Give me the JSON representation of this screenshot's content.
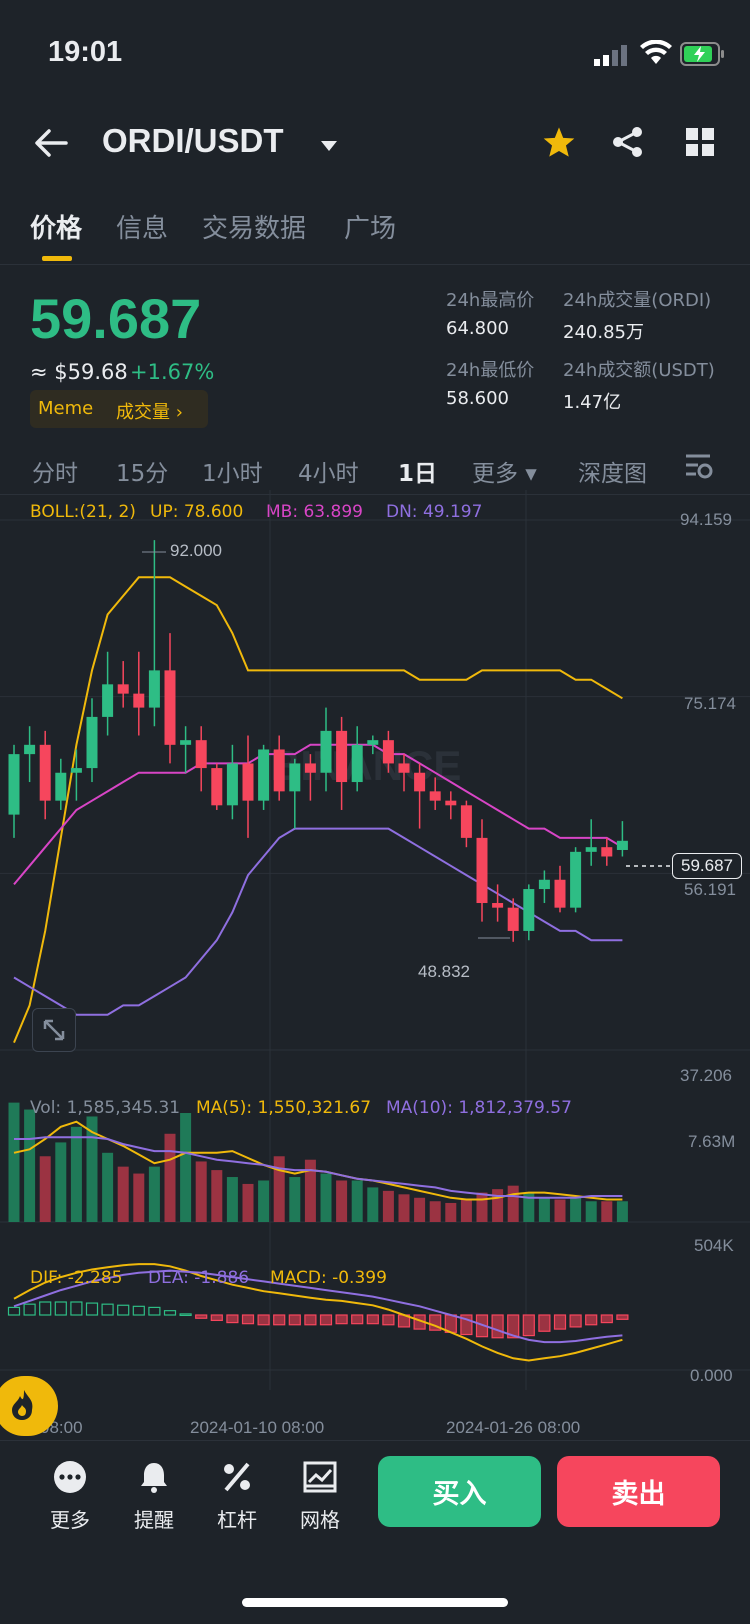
{
  "status_bar": {
    "time": "19:01"
  },
  "nav": {
    "pair": "ORDI/USDT"
  },
  "tabs": [
    "价格",
    "信息",
    "交易数据",
    "广场"
  ],
  "price": {
    "last": "59.687",
    "usd": "≈ $59.68",
    "change": "+1.67%",
    "tag_meme": "Meme",
    "tag_volume": "成交量 ›"
  },
  "stats": {
    "high_label": "24h最高价",
    "high": "64.800",
    "vol_ordi_label": "24h成交量(ORDI)",
    "vol_ordi": "240.85万",
    "low_label": "24h最低价",
    "low": "58.600",
    "vol_usdt_label": "24h成交额(USDT)",
    "vol_usdt": "1.47亿"
  },
  "intervals": [
    "分时",
    "15分",
    "1小时",
    "4小时",
    "1日",
    "更多 ▾",
    "深度图"
  ],
  "boll": {
    "label": "BOLL:(21, 2)",
    "up": "UP: 78.600",
    "mb": "MB: 63.899",
    "dn": "DN: 49.197"
  },
  "vol_legend": {
    "vol": "Vol: 1,585,345.31",
    "ma5": "MA(5): 1,550,321.67",
    "ma10": "MA(10): 1,812,379.57"
  },
  "macd_legend": {
    "dif": "DIF: -2.285",
    "dea": "DEA: -1.886",
    "macd": "MACD: -0.399"
  },
  "axis": {
    "price_ticks": [
      "94.159",
      "75.174",
      "56.191",
      "37.206"
    ],
    "vol_ticks": [
      "7.63M",
      "504K"
    ],
    "macd_tick": "0.000",
    "current_price": "59.687",
    "max_marker": "92.000",
    "min_marker": "48.832",
    "x_ticks": [
      "08:00",
      "2024-01-10 08:00",
      "2024-01-26 08:00"
    ]
  },
  "watermark": "BINANCE",
  "toolbar": {
    "more": "更多",
    "alert": "提醒",
    "margin": "杠杆",
    "grid": "网格"
  },
  "actions": {
    "buy": "买入",
    "sell": "卖出"
  },
  "colors": {
    "up": "#2ebd85",
    "down": "#f6465d",
    "boll_up": "#f0b90b",
    "boll_mb": "#d845c6",
    "boll_dn": "#8f6fe0",
    "accent": "#f0b90b"
  },
  "chart_data": {
    "type": "candlestick",
    "price_range": [
      37.206,
      94.159
    ],
    "candles": [
      {
        "o": 62.5,
        "h": 70.0,
        "l": 60.0,
        "c": 69.0
      },
      {
        "o": 69.0,
        "h": 72.0,
        "l": 66.0,
        "c": 70.0
      },
      {
        "o": 70.0,
        "h": 71.5,
        "l": 62.0,
        "c": 64.0
      },
      {
        "o": 64.0,
        "h": 68.5,
        "l": 63.0,
        "c": 67.0
      },
      {
        "o": 67.0,
        "h": 69.5,
        "l": 64.0,
        "c": 67.5
      },
      {
        "o": 67.5,
        "h": 75.0,
        "l": 66.0,
        "c": 73.0
      },
      {
        "o": 73.0,
        "h": 80.0,
        "l": 71.0,
        "c": 76.5
      },
      {
        "o": 76.5,
        "h": 79.0,
        "l": 74.0,
        "c": 75.5
      },
      {
        "o": 75.5,
        "h": 80.0,
        "l": 71.0,
        "c": 74.0
      },
      {
        "o": 74.0,
        "h": 92.0,
        "l": 72.0,
        "c": 78.0
      },
      {
        "o": 78.0,
        "h": 82.0,
        "l": 68.0,
        "c": 70.0
      },
      {
        "o": 70.0,
        "h": 72.0,
        "l": 67.0,
        "c": 70.5
      },
      {
        "o": 70.5,
        "h": 72.0,
        "l": 65.0,
        "c": 67.5
      },
      {
        "o": 67.5,
        "h": 68.0,
        "l": 63.0,
        "c": 63.5
      },
      {
        "o": 63.5,
        "h": 70.0,
        "l": 62.0,
        "c": 68.0
      },
      {
        "o": 68.0,
        "h": 71.0,
        "l": 60.0,
        "c": 64.0
      },
      {
        "o": 64.0,
        "h": 70.0,
        "l": 63.0,
        "c": 69.5
      },
      {
        "o": 69.5,
        "h": 71.0,
        "l": 64.0,
        "c": 65.0
      },
      {
        "o": 65.0,
        "h": 68.5,
        "l": 61.0,
        "c": 68.0
      },
      {
        "o": 68.0,
        "h": 69.0,
        "l": 64.0,
        "c": 67.0
      },
      {
        "o": 67.0,
        "h": 74.0,
        "l": 65.0,
        "c": 71.5
      },
      {
        "o": 71.5,
        "h": 73.0,
        "l": 63.0,
        "c": 66.0
      },
      {
        "o": 66.0,
        "h": 72.0,
        "l": 65.0,
        "c": 70.0
      },
      {
        "o": 70.0,
        "h": 71.0,
        "l": 69.0,
        "c": 70.5
      },
      {
        "o": 70.5,
        "h": 71.5,
        "l": 67.0,
        "c": 68.0
      },
      {
        "o": 68.0,
        "h": 69.0,
        "l": 65.0,
        "c": 67.0
      },
      {
        "o": 67.0,
        "h": 68.0,
        "l": 61.0,
        "c": 65.0
      },
      {
        "o": 65.0,
        "h": 66.5,
        "l": 63.0,
        "c": 64.0
      },
      {
        "o": 64.0,
        "h": 65.0,
        "l": 62.0,
        "c": 63.5
      },
      {
        "o": 63.5,
        "h": 64.0,
        "l": 59.0,
        "c": 60.0
      },
      {
        "o": 60.0,
        "h": 62.0,
        "l": 51.0,
        "c": 53.0
      },
      {
        "o": 53.0,
        "h": 55.0,
        "l": 51.0,
        "c": 52.5
      },
      {
        "o": 52.5,
        "h": 53.5,
        "l": 48.832,
        "c": 50.0
      },
      {
        "o": 50.0,
        "h": 55.0,
        "l": 49.0,
        "c": 54.5
      },
      {
        "o": 54.5,
        "h": 56.5,
        "l": 53.0,
        "c": 55.5
      },
      {
        "o": 55.5,
        "h": 57.0,
        "l": 52.0,
        "c": 52.5
      },
      {
        "o": 52.5,
        "h": 59.0,
        "l": 52.0,
        "c": 58.5
      },
      {
        "o": 58.5,
        "h": 62.0,
        "l": 57.0,
        "c": 59.0
      },
      {
        "o": 59.0,
        "h": 60.0,
        "l": 57.0,
        "c": 58.0
      },
      {
        "o": 58.7,
        "h": 61.8,
        "l": 58.0,
        "c": 59.687
      }
    ],
    "boll_up": [
      38,
      42,
      50,
      60,
      70,
      78,
      84,
      86,
      88,
      88,
      88,
      87,
      86,
      85,
      82,
      78,
      78,
      78,
      78,
      78,
      78,
      78,
      78,
      78,
      78,
      78,
      77,
      77,
      77,
      77,
      78,
      78,
      78,
      78,
      78,
      78,
      77,
      77,
      76,
      75
    ],
    "boll_mb": [
      55,
      57,
      59,
      61,
      63,
      64,
      65,
      66,
      67,
      67,
      67,
      67,
      68,
      68,
      68,
      68,
      69,
      69,
      69,
      70,
      70,
      70,
      70,
      70,
      69,
      69,
      68,
      67,
      66,
      65,
      64,
      63,
      62,
      61,
      61,
      60,
      60,
      60,
      60,
      59
    ],
    "boll_dn": [
      45,
      44,
      43,
      42,
      41,
      41,
      41,
      42,
      42,
      43,
      44,
      45,
      47,
      49,
      52,
      56,
      58,
      60,
      61,
      61,
      61,
      61,
      61,
      61,
      61,
      60,
      59,
      58,
      57,
      56,
      55,
      54,
      53,
      52,
      51,
      50,
      50,
      49,
      49,
      49
    ],
    "volume_range": [
      0,
      7630000
    ],
    "volume": [
      6.9,
      6.5,
      3.8,
      4.6,
      5.5,
      6.1,
      4.0,
      3.2,
      2.8,
      3.2,
      5.1,
      6.3,
      3.5,
      3.0,
      2.6,
      2.2,
      2.4,
      3.8,
      2.6,
      3.6,
      2.8,
      2.4,
      2.4,
      2.0,
      1.8,
      1.6,
      1.4,
      1.2,
      1.1,
      1.3,
      1.7,
      1.9,
      2.1,
      1.7,
      1.4,
      1.3,
      1.4,
      1.2,
      1.2,
      1.2
    ],
    "volume_ma5": [
      4.0,
      4.2,
      4.8,
      5.5,
      5.8,
      5.2,
      4.8,
      4.4,
      3.9,
      3.4,
      3.6,
      4.0,
      4.0,
      4.0,
      4.1,
      3.7,
      3.3,
      3.0,
      2.8,
      3.0,
      2.9,
      2.7,
      2.5,
      2.4,
      2.2,
      2.0,
      1.8,
      1.6,
      1.4,
      1.3,
      1.3,
      1.4,
      1.6,
      1.7,
      1.7,
      1.6,
      1.5,
      1.4,
      1.3,
      1.3
    ],
    "volume_ma10": [
      4.8,
      4.8,
      4.9,
      4.9,
      4.9,
      4.9,
      4.8,
      4.5,
      4.3,
      4.1,
      4.1,
      4.0,
      3.8,
      3.6,
      3.5,
      3.4,
      3.3,
      3.1,
      3.0,
      3.0,
      2.9,
      2.7,
      2.5,
      2.4,
      2.3,
      2.2,
      2.1,
      2.0,
      1.8,
      1.7,
      1.6,
      1.5,
      1.5,
      1.4,
      1.4,
      1.4,
      1.4,
      1.5,
      1.5,
      1.5
    ],
    "macd_range": [
      -6,
      6
    ],
    "dif": [
      1.5,
      2.3,
      3.0,
      3.5,
      3.9,
      4.2,
      4.4,
      4.6,
      4.7,
      4.7,
      4.5,
      4.1,
      3.6,
      3.2,
      2.8,
      2.5,
      2.2,
      2.0,
      1.8,
      1.6,
      1.4,
      1.3,
      1.1,
      0.9,
      0.5,
      0.0,
      -0.5,
      -1.0,
      -1.6,
      -2.2,
      -2.9,
      -3.5,
      -4.0,
      -4.2,
      -4.0,
      -3.8,
      -3.5,
      -3.1,
      -2.7,
      -2.285
    ],
    "dea": [
      0.8,
      1.3,
      1.8,
      2.3,
      2.7,
      3.1,
      3.4,
      3.7,
      3.9,
      4.0,
      4.1,
      4.0,
      3.9,
      3.7,
      3.5,
      3.3,
      3.1,
      2.9,
      2.7,
      2.5,
      2.3,
      2.1,
      1.9,
      1.7,
      1.4,
      1.1,
      0.8,
      0.4,
      0.0,
      -0.4,
      -0.9,
      -1.4,
      -1.9,
      -2.3,
      -2.5,
      -2.5,
      -2.4,
      -2.2,
      -2.0,
      -1.886
    ],
    "macd_hist": [
      0.7,
      1.0,
      1.2,
      1.2,
      1.2,
      1.1,
      1.0,
      0.9,
      0.8,
      0.7,
      0.4,
      0.1,
      -0.3,
      -0.5,
      -0.7,
      -0.8,
      -0.9,
      -0.9,
      -0.9,
      -0.9,
      -0.9,
      -0.8,
      -0.8,
      -0.8,
      -0.9,
      -1.1,
      -1.3,
      -1.4,
      -1.6,
      -1.8,
      -2.0,
      -2.1,
      -2.1,
      -1.9,
      -1.5,
      -1.3,
      -1.1,
      -0.9,
      -0.7,
      -0.399
    ]
  }
}
